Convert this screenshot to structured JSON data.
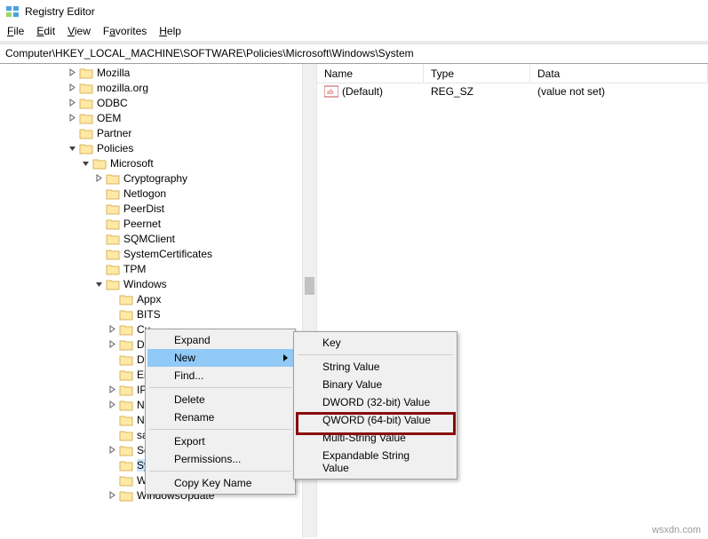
{
  "window": {
    "title": "Registry Editor"
  },
  "menu": {
    "file": "File",
    "edit": "Edit",
    "view": "View",
    "favorites": "Favorites",
    "help": "Help"
  },
  "path": "Computer\\HKEY_LOCAL_MACHINE\\SOFTWARE\\Policies\\Microsoft\\Windows\\System",
  "list": {
    "headers": {
      "name": "Name",
      "type": "Type",
      "data": "Data"
    },
    "rows": [
      {
        "name": "(Default)",
        "type": "REG_SZ",
        "data": "(value not set)"
      }
    ]
  },
  "tree": [
    {
      "indent": 3,
      "exp": "closed",
      "label": "Mozilla"
    },
    {
      "indent": 3,
      "exp": "closed",
      "label": "mozilla.org"
    },
    {
      "indent": 3,
      "exp": "closed",
      "label": "ODBC"
    },
    {
      "indent": 3,
      "exp": "closed",
      "label": "OEM"
    },
    {
      "indent": 3,
      "exp": "none",
      "label": "Partner"
    },
    {
      "indent": 3,
      "exp": "open",
      "label": "Policies"
    },
    {
      "indent": 4,
      "exp": "open",
      "label": "Microsoft"
    },
    {
      "indent": 5,
      "exp": "closed",
      "label": "Cryptography"
    },
    {
      "indent": 5,
      "exp": "none",
      "label": "Netlogon"
    },
    {
      "indent": 5,
      "exp": "none",
      "label": "PeerDist"
    },
    {
      "indent": 5,
      "exp": "none",
      "label": "Peernet"
    },
    {
      "indent": 5,
      "exp": "none",
      "label": "SQMClient"
    },
    {
      "indent": 5,
      "exp": "none",
      "label": "SystemCertificates"
    },
    {
      "indent": 5,
      "exp": "none",
      "label": "TPM"
    },
    {
      "indent": 5,
      "exp": "open",
      "label": "Windows"
    },
    {
      "indent": 6,
      "exp": "none",
      "label": "Appx"
    },
    {
      "indent": 6,
      "exp": "none",
      "label": "BITS"
    },
    {
      "indent": 6,
      "exp": "closed",
      "label": "Cu"
    },
    {
      "indent": 6,
      "exp": "closed",
      "label": "Da"
    },
    {
      "indent": 6,
      "exp": "none",
      "label": "Dri"
    },
    {
      "indent": 6,
      "exp": "none",
      "label": "En"
    },
    {
      "indent": 6,
      "exp": "closed",
      "label": "IPS"
    },
    {
      "indent": 6,
      "exp": "closed",
      "label": "Ne"
    },
    {
      "indent": 6,
      "exp": "none",
      "label": "Ne"
    },
    {
      "indent": 6,
      "exp": "none",
      "label": "saf"
    },
    {
      "indent": 6,
      "exp": "closed",
      "label": "Set"
    },
    {
      "indent": 6,
      "exp": "none",
      "label": "System",
      "selected": true
    },
    {
      "indent": 6,
      "exp": "none",
      "label": "WcmSvc"
    },
    {
      "indent": 6,
      "exp": "closed",
      "label": "WindowsUpdate"
    }
  ],
  "context_menu_1": {
    "items": [
      {
        "label": "Expand"
      },
      {
        "label": "New",
        "submenu": true,
        "hover": true
      },
      {
        "label": "Find..."
      },
      {
        "sep": true
      },
      {
        "label": "Delete"
      },
      {
        "label": "Rename"
      },
      {
        "sep": true
      },
      {
        "label": "Export"
      },
      {
        "label": "Permissions..."
      },
      {
        "sep": true
      },
      {
        "label": "Copy Key Name"
      }
    ]
  },
  "context_menu_2": {
    "items": [
      {
        "label": "Key"
      },
      {
        "sep": true
      },
      {
        "label": "String Value"
      },
      {
        "label": "Binary Value"
      },
      {
        "label": "DWORD (32-bit) Value",
        "highlight": true
      },
      {
        "label": "QWORD (64-bit) Value"
      },
      {
        "label": "Multi-String Value"
      },
      {
        "label": "Expandable String Value"
      }
    ]
  },
  "watermark": "wsxdn.com"
}
